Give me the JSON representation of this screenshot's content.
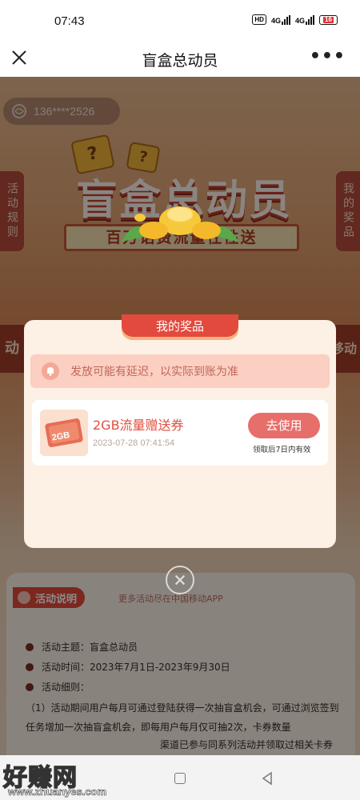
{
  "status_bar": {
    "time": "07:43",
    "hd": "HD",
    "net1": "4G",
    "net2": "4G",
    "battery": "16"
  },
  "nav": {
    "title": "盲盒总动员",
    "more": "•••"
  },
  "background": {
    "phone": "136****2526",
    "banner_title": "盲盒总动员",
    "subtitle": "百万话费流量任性送",
    "left_tab": "活动规则",
    "right_tab": "我的奖品",
    "deco_box_glyph": "?",
    "left_deco": "动",
    "right_deco": "移动"
  },
  "modal": {
    "title": "我的奖品",
    "notice": "发放可能有延迟，以实际到账为准",
    "prize": {
      "thumb_label": "2GB",
      "name": "2GB流量赠送券",
      "date": "2023-07-28 07:41:54",
      "button": "去使用",
      "valid": "领取后7日内有效"
    }
  },
  "activity": {
    "header": "活动说明",
    "more": "更多活动尽在中国移动APP",
    "theme_label": "活动主题：",
    "theme_value": "盲盒总动员",
    "time_label": "活动时间：",
    "time_value": "2023年7月1日-2023年9月30日",
    "detail_label": "活动细则：",
    "detail_text": "（1）活动期间用户每月可通过登陆获得一次抽盲盒机会，可通过浏览签到任务增加一次抽盲盒机会，即每用户每月仅可抽2次，卡券数量",
    "detail_more": "渠道已参与同系列活动并领取过相关卡券"
  },
  "watermark": {
    "text": "好赚网",
    "url": "www.zhuanyes.com"
  },
  "colors": {
    "accent": "#e24a3d",
    "button": "#e76f6b",
    "modal_bg": "#fdf0e4"
  },
  "icons": [
    "close-icon",
    "more-icon",
    "bell-icon",
    "mobile-logo-icon",
    "close-circle-icon",
    "nav-home-icon",
    "nav-back-icon"
  ]
}
